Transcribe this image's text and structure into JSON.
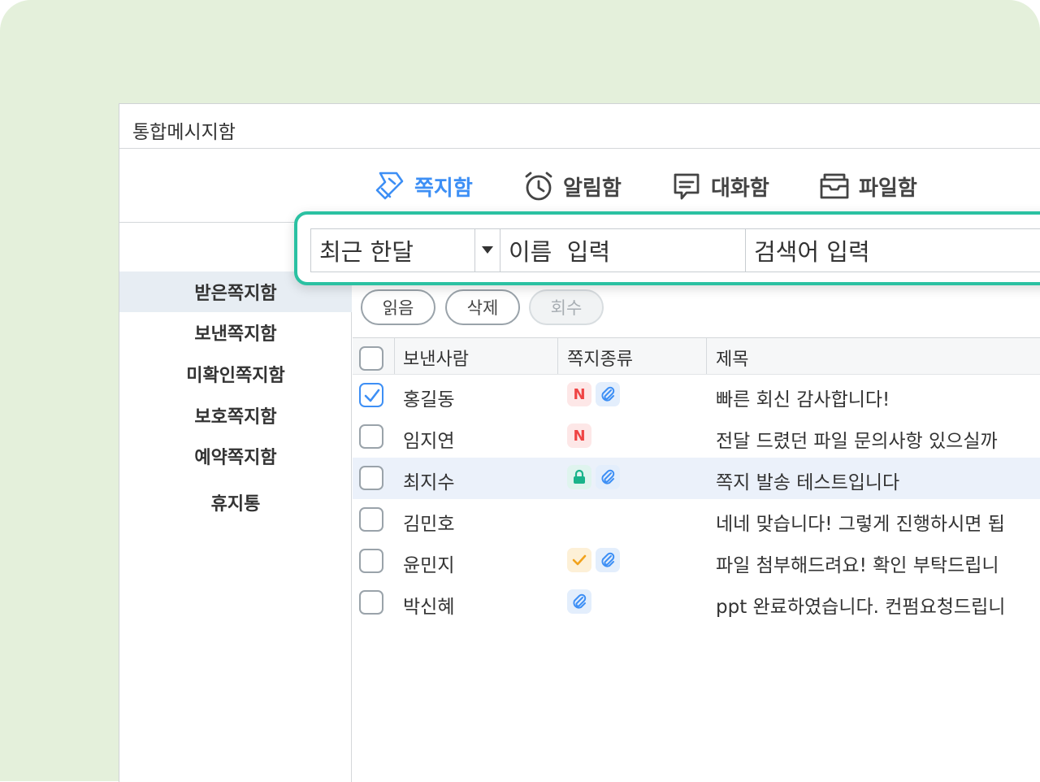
{
  "window": {
    "title": "통합메시지함"
  },
  "tabs": [
    {
      "label": "쪽지함",
      "icon": "note-icon",
      "active": true
    },
    {
      "label": "알림함",
      "icon": "alarm-clock-icon",
      "active": false
    },
    {
      "label": "대화함",
      "icon": "chat-bubble-icon",
      "active": false
    },
    {
      "label": "파일함",
      "icon": "file-tray-icon",
      "active": false
    }
  ],
  "search": {
    "period": "최근 한달",
    "name_placeholder": "이름  입력",
    "keyword_placeholder": "검색어 입력"
  },
  "sidebar": {
    "items": [
      {
        "label": "받은쪽지함",
        "selected": true
      },
      {
        "label": "보낸쪽지함",
        "selected": false
      },
      {
        "label": "미확인쪽지함",
        "selected": false
      },
      {
        "label": "보호쪽지함",
        "selected": false
      },
      {
        "label": "예약쪽지함",
        "selected": false
      },
      {
        "label": "휴지통",
        "selected": false
      }
    ]
  },
  "actions": {
    "read": "읽음",
    "delete": "삭제",
    "recall": "회수"
  },
  "table": {
    "headers": {
      "sender": "보낸사람",
      "type": "쪽지종류",
      "subject": "제목"
    },
    "rows": [
      {
        "sender": "홍길동",
        "subject": "빠른 회신 감사합니다!",
        "checked": true,
        "icons": [
          "new",
          "attachment"
        ]
      },
      {
        "sender": "임지연",
        "subject": "전달 드렸던 파일 문의사항 있으실까",
        "checked": false,
        "icons": [
          "new"
        ]
      },
      {
        "sender": "최지수",
        "subject": "쪽지 발송 테스트입니다",
        "checked": false,
        "highlighted": true,
        "icons": [
          "lock",
          "attachment"
        ]
      },
      {
        "sender": "김민호",
        "subject": "네네 맞습니다! 그렇게 진행하시면 됩",
        "checked": false,
        "icons": []
      },
      {
        "sender": "윤민지",
        "subject": "파일 첨부해드려요! 확인 부탁드립니",
        "checked": false,
        "icons": [
          "check",
          "attachment"
        ]
      },
      {
        "sender": "박신혜",
        "subject": "ppt 완료하였습니다. 컨펌요청드립니",
        "checked": false,
        "icons": [
          "attachment"
        ]
      }
    ],
    "badge_new_text": "N"
  },
  "colors": {
    "accent": "#3d8ff5",
    "highlight_outline": "#2bc1a2",
    "background": "#e4f0db"
  }
}
